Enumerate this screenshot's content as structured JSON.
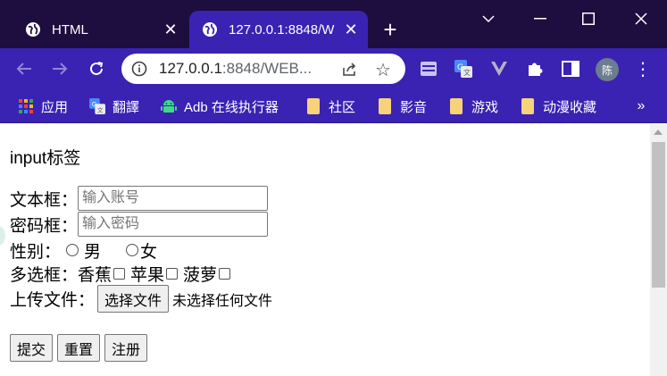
{
  "tabs": [
    {
      "title": "HTML",
      "active": false
    },
    {
      "title": "127.0.0.1:8848/W",
      "active": true
    }
  ],
  "toolbar": {
    "url_host": "127.0.0.1",
    "url_path": ":8848/WEB..."
  },
  "profile": {
    "avatar_label": "陈"
  },
  "bookmarks": [
    {
      "label": "应用",
      "icon": "apps-grid-icon"
    },
    {
      "label": "翻譯",
      "icon": "translate-icon"
    },
    {
      "label": "Adb 在线执行器",
      "icon": "android-icon"
    },
    {
      "label": "社区",
      "icon": "folder-icon"
    },
    {
      "label": "影音",
      "icon": "folder-icon"
    },
    {
      "label": "游戏",
      "icon": "folder-icon"
    },
    {
      "label": "动漫收藏",
      "icon": "folder-icon"
    }
  ],
  "page": {
    "heading": "input标签",
    "username": {
      "label": "文本框：",
      "placeholder": "输入账号",
      "value": ""
    },
    "password": {
      "label": "密码框：",
      "placeholder": "输入密码",
      "value": ""
    },
    "gender": {
      "label": "性别：",
      "options": [
        "男",
        "女"
      ]
    },
    "hobbies": {
      "label": "多选框：",
      "options": [
        "香蕉",
        "苹果",
        "菠萝"
      ]
    },
    "upload": {
      "label": "上传文件：",
      "button": "选择文件",
      "status": "未选择任何文件"
    },
    "buttons": {
      "submit": "提交",
      "reset": "重置",
      "register": "注册"
    }
  },
  "colors": {
    "titlebar": "#1e0d3f",
    "toolbar": "#3a22b3",
    "folder": "#f7d27a"
  }
}
